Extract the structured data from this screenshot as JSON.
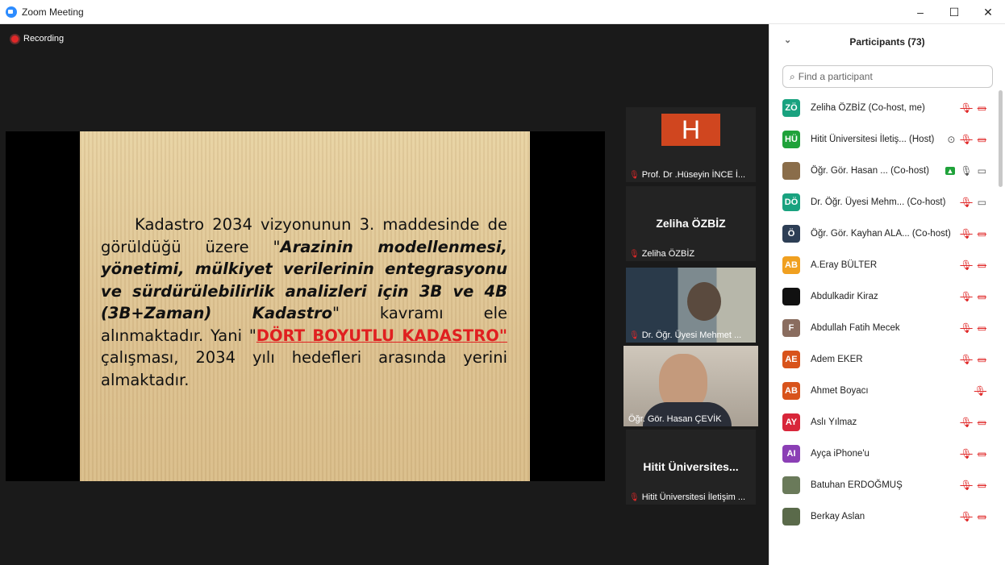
{
  "window": {
    "title": "Zoom Meeting",
    "controls": [
      "–",
      "☐",
      "✕"
    ]
  },
  "recording_label": "Recording",
  "slide": {
    "p1": "Kadastro 2034 vizyonunun 3. maddesinde de görüldüğü üzere \"",
    "bold": "Arazinin modellenmesi, yönetimi, mülkiyet verilerinin entegrasyonu ve sürdürülebilirlik analizleri için 3B ve 4B (3B+Zaman) Kadastro",
    "p2": "\" kavramı ele alınmaktadır. Yani \"",
    "red": "DÖRT BOYUTLU KADASTRO\" ",
    "p3": " çalışması, 2034 yılı hedefleri arasında yerini almaktadır."
  },
  "tiles": [
    {
      "name": "Prof. Dr .Hüseyin İNCE İ...",
      "avatar_letter": "H"
    },
    {
      "center": "Zeliha ÖZBİZ",
      "name": "Zeliha ÖZBİZ"
    },
    {
      "name": "Dr. Öğr. Üyesi Mehmet ..."
    },
    {
      "name": "Öğr. Gör. Hasan ÇEVİK"
    },
    {
      "center": "Hitit Üniversites...",
      "name": "Hitit Üniversitesi İletişim ..."
    }
  ],
  "participants": {
    "header": "Participants (73)",
    "search_placeholder": "Find a participant",
    "items": [
      {
        "initials": "ZÖ",
        "color": "#19a27f",
        "name": "Zeliha ÖZBİZ (Co-host, me)"
      },
      {
        "initials": "HÜ",
        "color": "#1fa23a",
        "name": "Hitit Üniversitesi İletiş... (Host)"
      },
      {
        "initials": "",
        "color": "#8a6d4a",
        "name": "Öğr. Gör. Hasan ...  (Co-host)"
      },
      {
        "initials": "DÖ",
        "color": "#19a27f",
        "name": "Dr. Öğr. Üyesi Mehm...  (Co-host)"
      },
      {
        "initials": "Ö",
        "color": "#2d3e55",
        "name": "Öğr. Gör. Kayhan ALA... (Co-host)"
      },
      {
        "initials": "AB",
        "color": "#f0a020",
        "name": "A.Eray BÜLTER"
      },
      {
        "initials": "",
        "color": "#111111",
        "name": "Abdulkadir Kiraz"
      },
      {
        "initials": "F",
        "color": "#8a6d5f",
        "name": "Abdullah Fatih Mecek"
      },
      {
        "initials": "AE",
        "color": "#d8531b",
        "name": "Adem EKER"
      },
      {
        "initials": "AB",
        "color": "#d8531b",
        "name": "Ahmet Boyacı"
      },
      {
        "initials": "AY",
        "color": "#d8263a",
        "name": "Aslı Yılmaz"
      },
      {
        "initials": "AI",
        "color": "#8b3fb5",
        "name": "Ayça iPhone'u"
      },
      {
        "initials": "",
        "color": "#6a7a5a",
        "name": "Batuhan ERDOĞMUŞ"
      },
      {
        "initials": "",
        "color": "#5a6a4a",
        "name": "Berkay Aslan"
      }
    ]
  }
}
